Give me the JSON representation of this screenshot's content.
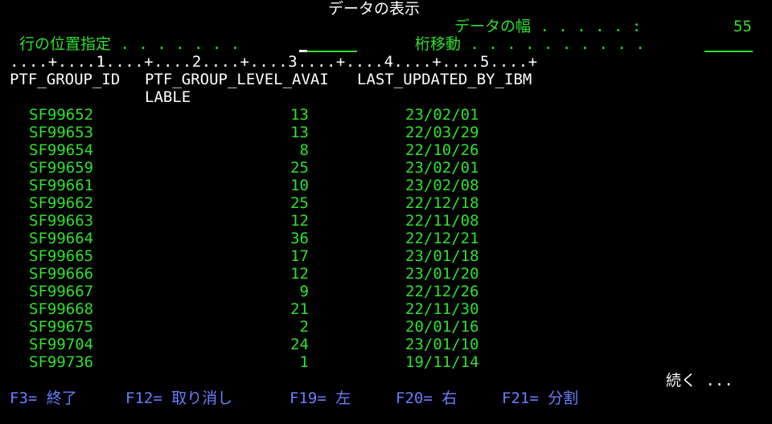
{
  "header": {
    "title": "データの表示",
    "width_label": "データの幅 . . . . . :",
    "width_value": "55",
    "position_label": "行の位置指定 . . . . . . .",
    "shift_label": "桁移動 . . . . . . . . . ."
  },
  "ruler": "....+....1....+....2....+....3....+....4....+....5....+",
  "columns": {
    "col1": "PTF_GROUP_ID",
    "col2_line1": "PTF_GROUP_LEVEL_AVAI",
    "col2_line2": "LABLE",
    "col3": "LAST_UPDATED_BY_IBM"
  },
  "rows": [
    {
      "id": "SF99652",
      "level": "13",
      "updated": "23/02/01"
    },
    {
      "id": "SF99653",
      "level": "13",
      "updated": "22/03/29"
    },
    {
      "id": "SF99654",
      "level": "8",
      "updated": "22/10/26"
    },
    {
      "id": "SF99659",
      "level": "25",
      "updated": "23/02/01"
    },
    {
      "id": "SF99661",
      "level": "10",
      "updated": "23/02/08"
    },
    {
      "id": "SF99662",
      "level": "25",
      "updated": "22/12/18"
    },
    {
      "id": "SF99663",
      "level": "12",
      "updated": "22/11/08"
    },
    {
      "id": "SF99664",
      "level": "36",
      "updated": "22/12/21"
    },
    {
      "id": "SF99665",
      "level": "17",
      "updated": "23/01/18"
    },
    {
      "id": "SF99666",
      "level": "12",
      "updated": "23/01/20"
    },
    {
      "id": "SF99667",
      "level": "9",
      "updated": "22/12/26"
    },
    {
      "id": "SF99668",
      "level": "21",
      "updated": "22/11/30"
    },
    {
      "id": "SF99675",
      "level": "2",
      "updated": "20/01/16"
    },
    {
      "id": "SF99704",
      "level": "24",
      "updated": "23/01/10"
    },
    {
      "id": "SF99736",
      "level": "1",
      "updated": "19/11/14"
    }
  ],
  "more": "続く ...",
  "function_keys": {
    "f3": "F3= 終了",
    "f12": "F12= 取り消し",
    "f19": "F19= 左",
    "f20": "F20= 右",
    "f21": "F21= 分割"
  },
  "colors": {
    "background": "#000000",
    "text_white": "#ffffff",
    "text_green": "#2ee02e",
    "text_blue": "#6c7dff"
  }
}
